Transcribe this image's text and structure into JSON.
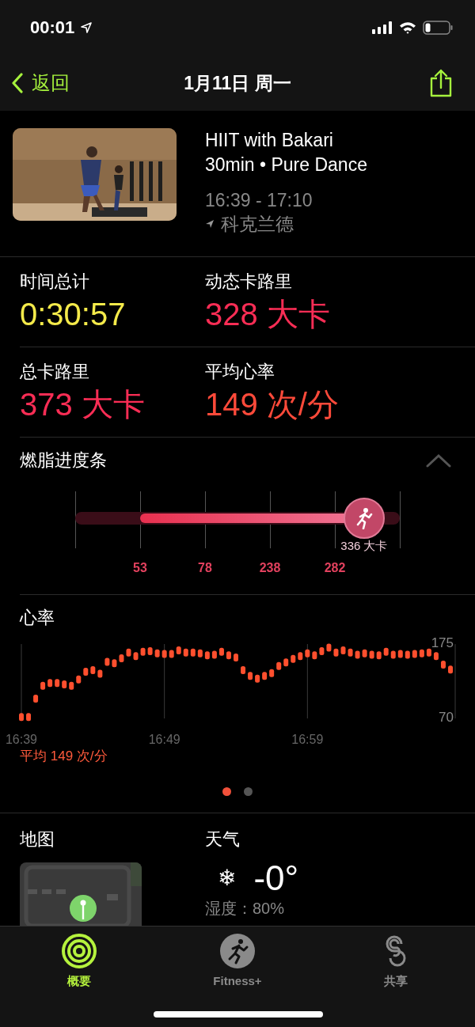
{
  "status_bar": {
    "time": "00:01"
  },
  "nav": {
    "back": "返回",
    "title": "1月11日 周一"
  },
  "workout": {
    "kind": "picture",
    "title": "HIIT with Bakari",
    "subtitle": "30min • Pure Dance",
    "time_range": "16:39 - 17:10",
    "location": "科克兰德"
  },
  "stats": [
    {
      "label": "时间总计",
      "value": "0:30:57",
      "kind": "time"
    },
    {
      "label": "动态卡路里",
      "value": "328 大卡",
      "kind": "calories"
    },
    {
      "label": "总卡路里",
      "value": "373 大卡",
      "kind": "calories"
    },
    {
      "label": "平均心率",
      "value": "149 次/分",
      "kind": "heart_rate"
    }
  ],
  "burn_bar": {
    "title": "燃脂进度条",
    "expanded": true,
    "ticks": [
      "53",
      "78",
      "238",
      "282"
    ],
    "level": 0.89,
    "reading": "336 大卡"
  },
  "heart_rate": {
    "title": "心率",
    "average": "平均 149 次/分",
    "chart_data": {
      "type": "scatter",
      "grid": true,
      "ylim": [
        70,
        175
      ],
      "yticks": [
        70,
        175
      ],
      "categories": [
        "16:39",
        null,
        null,
        null,
        null,
        null,
        null,
        null,
        null,
        null,
        null,
        null,
        null,
        null,
        null,
        null,
        null,
        null,
        null,
        null,
        "16:49",
        null,
        null,
        null,
        null,
        null,
        null,
        null,
        null,
        null,
        null,
        null,
        null,
        null,
        null,
        null,
        null,
        null,
        null,
        null,
        "16:59",
        null,
        null,
        null,
        null,
        null,
        null,
        null,
        null,
        null,
        null,
        null,
        null,
        null,
        null,
        null,
        null,
        null,
        null,
        null,
        null
      ],
      "series": [
        {
          "color": "#ff4f2e",
          "values": [
            72,
            72,
            98,
            116,
            120,
            120,
            118,
            116,
            125,
            136,
            138,
            133,
            150,
            148,
            155,
            163,
            158,
            164,
            165,
            162,
            161,
            161,
            166,
            163,
            163,
            162,
            159,
            160,
            164,
            159,
            156,
            138,
            130,
            126,
            130,
            134,
            144,
            149,
            154,
            158,
            162,
            159,
            165,
            170,
            163,
            166,
            163,
            160,
            162,
            160,
            159,
            164,
            160,
            161,
            160,
            161,
            162,
            163,
            158,
            146,
            139
          ]
        }
      ]
    }
  },
  "page_dots": [
    {
      "selected": true
    },
    {
      "selected": false
    }
  ],
  "map": {
    "title": "地图",
    "kind": "picture"
  },
  "weather": {
    "title": "天气",
    "icon": "❄",
    "temperature": "-0°",
    "humidity": "湿度：80%"
  },
  "tab_bar": [
    {
      "label": "概要",
      "kind": "rings",
      "selected": true
    },
    {
      "label": "Fitness+",
      "kind": "runner",
      "selected": false
    },
    {
      "label": "共享",
      "kind": "share",
      "selected": false
    }
  ]
}
